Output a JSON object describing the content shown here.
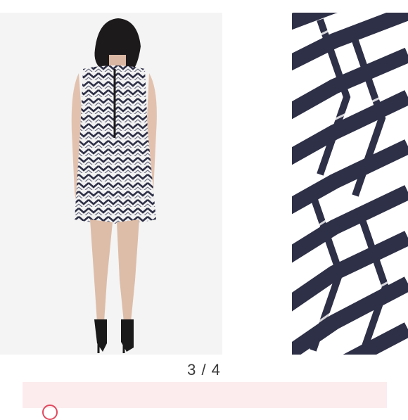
{
  "gallery": {
    "counter": "3 / 4",
    "left_image": "model-back-view",
    "right_image": "fabric-chevron-closeup"
  },
  "colors": {
    "navy": "#2e3047",
    "white": "#ffffff",
    "banner_bg": "#fcecee",
    "accent": "#e1495e"
  }
}
